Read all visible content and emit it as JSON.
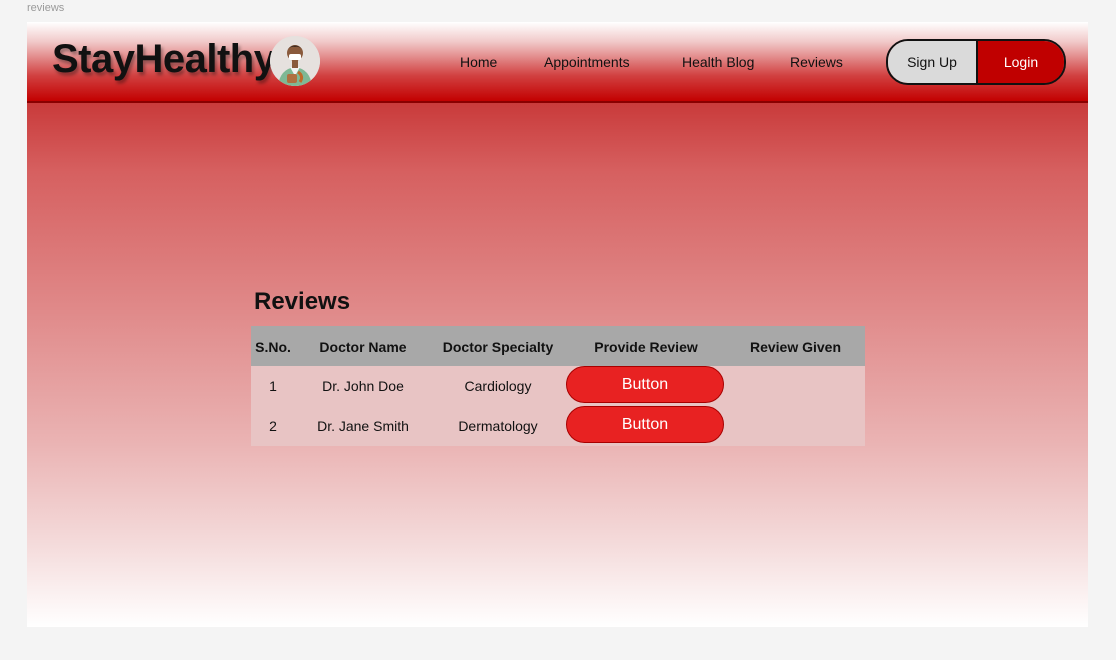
{
  "frame_label": "reviews",
  "brand": {
    "name": "StayHealthy"
  },
  "nav": {
    "links": [
      "Home",
      "Appointments",
      "Health Blog",
      "Reviews"
    ],
    "signup_label": "Sign Up",
    "login_label": "Login"
  },
  "page": {
    "title": "Reviews"
  },
  "table": {
    "headers": [
      "S.No.",
      "Doctor Name",
      "Doctor Specialty",
      "Provide Review",
      "Review Given"
    ],
    "rows": [
      {
        "sno": "1",
        "doctor_name": "Dr. John Doe",
        "specialty": "Cardiology",
        "button_label": "Button",
        "review_given": ""
      },
      {
        "sno": "2",
        "doctor_name": "Dr. Jane Smith",
        "specialty": "Dermatology",
        "button_label": "Button",
        "review_given": ""
      }
    ]
  },
  "colors": {
    "brand_red": "#c00000",
    "button_red": "#e82222",
    "header_gray": "#a8a8a8",
    "row_pink": "#e8c4c4"
  },
  "icons": {
    "logo": "doctor-avatar-icon"
  }
}
